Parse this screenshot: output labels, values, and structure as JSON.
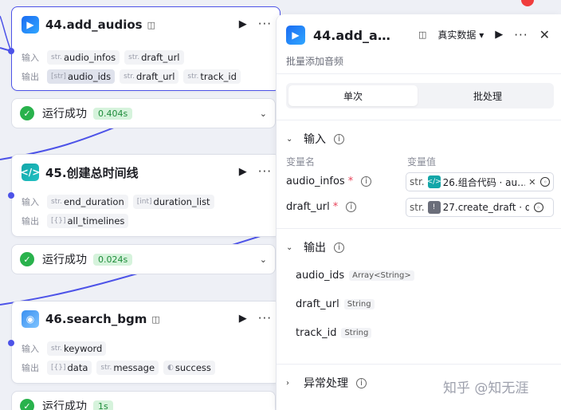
{
  "nodes": [
    {
      "title": "44.add_audios",
      "icon": "audio-plugin-icon",
      "input_label": "输入",
      "output_label": "输出",
      "inputs": [
        {
          "type": "str.",
          "name": "audio_infos"
        },
        {
          "type": "str.",
          "name": "draft_url"
        }
      ],
      "outputs": [
        {
          "type": "[str]",
          "name": "audio_ids"
        },
        {
          "type": "str.",
          "name": "draft_url"
        },
        {
          "type": "str.",
          "name": "track_id"
        }
      ],
      "status": "运行成功",
      "time": "0.404s"
    },
    {
      "title": "45.创建总时间线",
      "icon": "code-icon",
      "input_label": "输入",
      "output_label": "输出",
      "inputs": [
        {
          "type": "str.",
          "name": "end_duration"
        },
        {
          "type": "[int]",
          "name": "duration_list"
        }
      ],
      "outputs": [
        {
          "type": "[{}]",
          "name": "all_timelines"
        }
      ],
      "status": "运行成功",
      "time": "0.024s"
    },
    {
      "title": "46.search_bgm",
      "icon": "search-plugin-icon",
      "input_label": "输入",
      "output_label": "输出",
      "inputs": [
        {
          "type": "str.",
          "name": "keyword"
        }
      ],
      "outputs": [
        {
          "type": "[{}]",
          "name": "data"
        },
        {
          "type": "str.",
          "name": "message"
        },
        {
          "type": "◐",
          "name": "success"
        }
      ],
      "status": "运行成功",
      "time": "1s"
    }
  ],
  "panel": {
    "title": "44.add_a…",
    "real_data_label": "真实数据",
    "description": "批量添加音频",
    "tabs": [
      "单次",
      "批处理"
    ],
    "input_section": "输入",
    "col_name": "变量名",
    "col_value": "变量值",
    "inputs": [
      {
        "name": "audio_infos",
        "type": "str.",
        "value": "26.组合代码 · au…",
        "source_color": "#13a6a8"
      },
      {
        "name": "draft_url",
        "type": "str.",
        "value": "27.create_draft · d",
        "source_color": "#6b6e7a"
      }
    ],
    "output_section": "输出",
    "outputs": [
      {
        "name": "audio_ids",
        "type": "Array<String>"
      },
      {
        "name": "draft_url",
        "type": "String"
      },
      {
        "name": "track_id",
        "type": "String"
      }
    ],
    "error_section": "异常处理"
  },
  "watermark": "知乎 @知无涯",
  "colors": {
    "accent": "#4d53e8",
    "success": "#29b24c",
    "required": "#e8445a",
    "notification": "#f03d3d"
  }
}
